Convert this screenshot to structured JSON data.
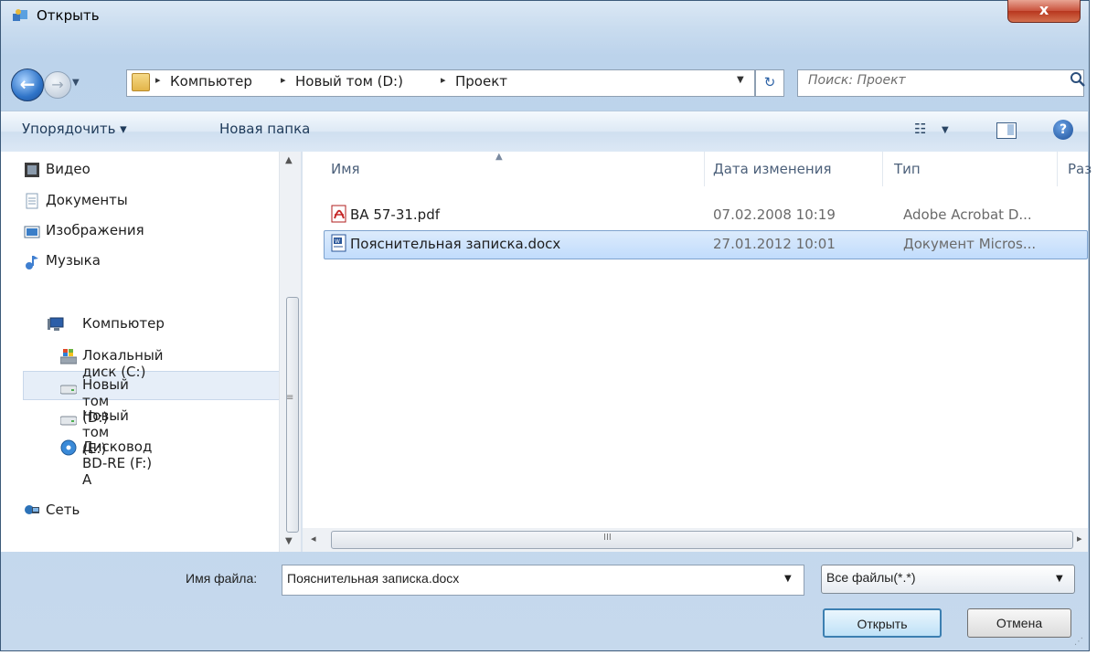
{
  "window": {
    "title": "Открыть",
    "close_glyph": "x"
  },
  "navigation": {
    "back_glyph": "←",
    "forward_glyph": "→",
    "breadcrumbs": [
      "Компьютер",
      "Новый том (D:)",
      "Проект"
    ],
    "separator_glyph": "▸",
    "refresh_glyph": "↻",
    "search_placeholder": "Поиск: Проект"
  },
  "toolbar": {
    "organize_label": "Упорядочить ▾",
    "new_folder_label": "Новая папка",
    "views_glyph": "☷",
    "help_glyph": "?"
  },
  "nav_pane": {
    "items": [
      {
        "label": "Видео",
        "icon": "video-icon",
        "color": "#3b3b3b"
      },
      {
        "label": "Документы",
        "icon": "documents-icon",
        "color": "#8aa0b8"
      },
      {
        "label": "Изображения",
        "icon": "pictures-icon",
        "color": "#3a7ec8"
      },
      {
        "label": "Музыка",
        "icon": "music-icon",
        "color": "#3f7fd0"
      },
      {
        "label": "Компьютер",
        "icon": "computer-icon",
        "color": "#2c5ea8"
      },
      {
        "label": "Локальный диск (C:)",
        "icon": "windows-drive-icon",
        "color": "#7a8795"
      },
      {
        "label": "Новый том (D:)",
        "icon": "drive-icon",
        "color": "#9aa5b0"
      },
      {
        "label": "Новый том (E:)",
        "icon": "drive-icon",
        "color": "#9aa5b0"
      },
      {
        "label": "Дисковод BD-RE (F:) A",
        "icon": "disc-drive-icon",
        "color": "#3a8ad8"
      },
      {
        "label": "Сеть",
        "icon": "network-icon",
        "color": "#2c72b8"
      }
    ],
    "selected_index": 6
  },
  "file_list": {
    "columns": [
      "Имя",
      "Дата изменения",
      "Тип",
      "Раз"
    ],
    "sort_glyph": "▲",
    "rows": [
      {
        "name": "ВА 57-31.pdf",
        "date": "07.02.2008 10:19",
        "type": "Adobe Acrobat D...",
        "icon": "pdf-file-icon"
      },
      {
        "name": "Пояснительная записка.docx",
        "date": "27.01.2012 10:01",
        "type": "Документ Micros...",
        "icon": "word-file-icon"
      }
    ],
    "selected_row": 1,
    "scroll_left_glyph": "◂",
    "scroll_right_glyph": "▸",
    "scroll_grip_glyph": "III"
  },
  "bottom": {
    "filename_label": "Имя файла:",
    "filename_value": "Пояснительная записка.docx",
    "filetype_value": "Все файлы(*.*)",
    "dropdown_glyph": "▼",
    "open_label": "Открыть",
    "cancel_label": "Отмена"
  },
  "colors": {
    "accent": "#3c7fb1",
    "selection": "#c1dcfc"
  }
}
